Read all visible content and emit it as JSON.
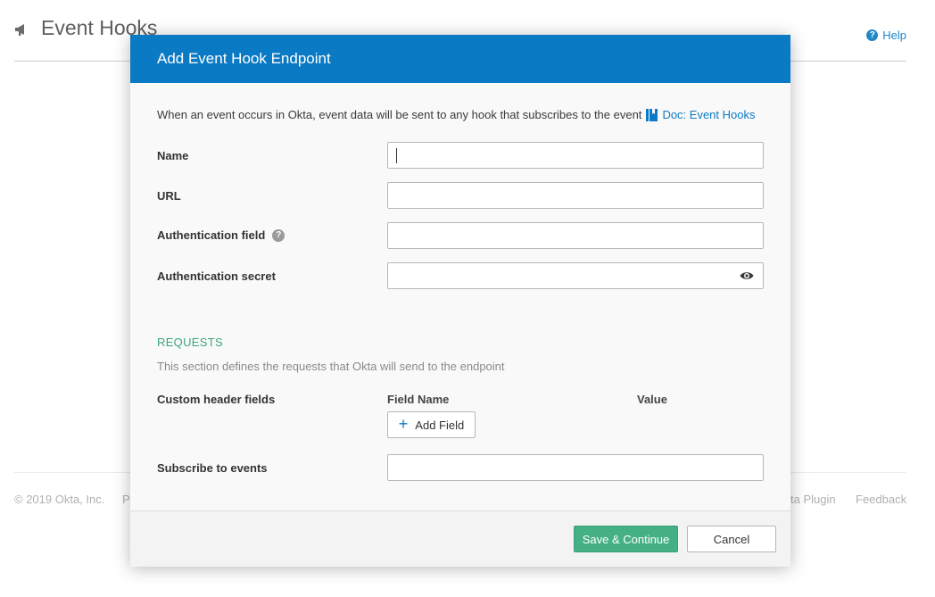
{
  "background": {
    "title": "Event Hooks",
    "help_label": "Help",
    "help_glyph": "?",
    "footer_copyright": "© 2019 Okta, Inc.",
    "footer_p": "P",
    "footer_plugin": "ta Plugin",
    "footer_feedback": "Feedback"
  },
  "modal": {
    "title": "Add Event Hook Endpoint",
    "intro_text": "When an event occurs in Okta, event data will be sent to any hook that subscribes to the event",
    "doc_link_label": "Doc: Event Hooks",
    "fields": {
      "name_label": "Name",
      "name_value": "",
      "url_label": "URL",
      "url_value": "",
      "auth_field_label": "Authentication field",
      "auth_field_help_glyph": "?",
      "auth_field_value": "",
      "auth_secret_label": "Authentication secret",
      "auth_secret_value": ""
    },
    "requests": {
      "title": "REQUESTS",
      "description": "This section defines the requests that Okta will send to the endpoint",
      "custom_header_label": "Custom header fields",
      "col_field_name": "Field Name",
      "col_value": "Value",
      "add_field_label": "Add Field",
      "subscribe_label": "Subscribe to events",
      "subscribe_value": ""
    },
    "footer": {
      "save_label": "Save & Continue",
      "cancel_label": "Cancel"
    }
  },
  "colors": {
    "header_blue": "#0b7ac4",
    "primary_green": "#45b084",
    "section_green": "#3ba77b"
  },
  "icons": [
    "megaphone-icon",
    "help-icon",
    "book-icon",
    "question-icon",
    "eye-icon",
    "plus-icon"
  ]
}
